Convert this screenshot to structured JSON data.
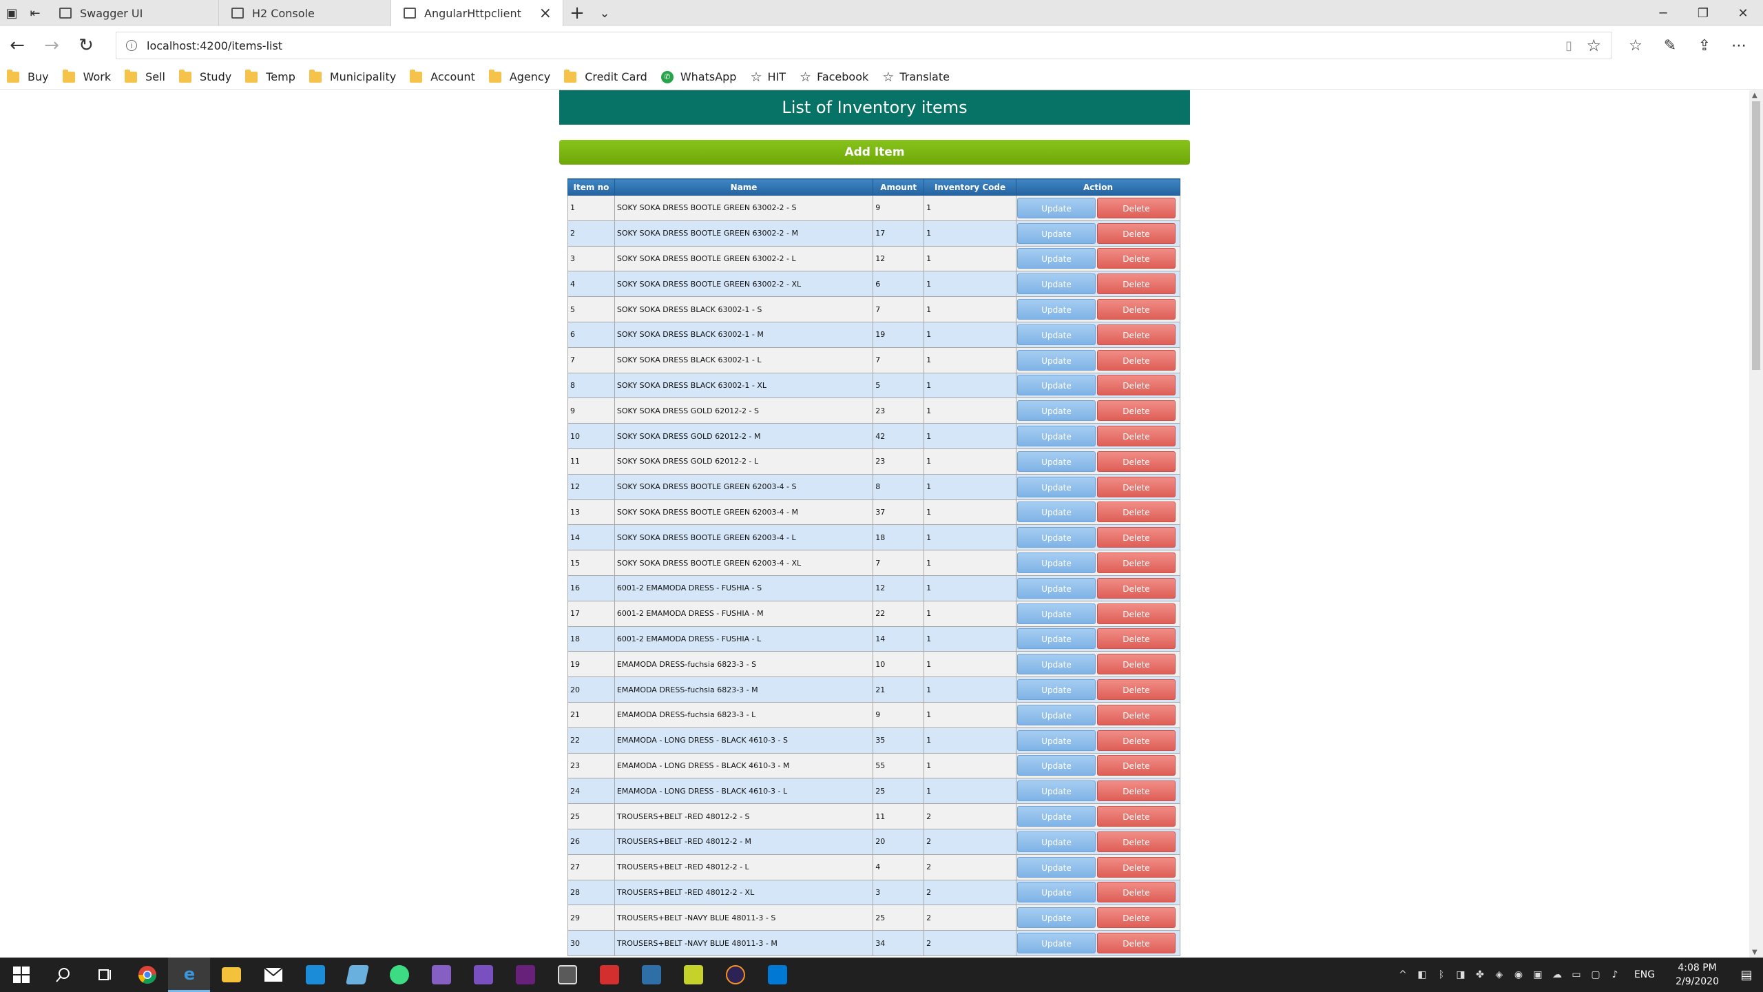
{
  "browser": {
    "tabs": [
      {
        "title": "Swagger UI",
        "active": false
      },
      {
        "title": "H2 Console",
        "active": false
      },
      {
        "title": "AngularHttpclient",
        "active": true
      }
    ],
    "url": "localhost:4200/items-list",
    "favorites": [
      {
        "label": "Buy",
        "icon": "folder-icon"
      },
      {
        "label": "Work",
        "icon": "folder-icon"
      },
      {
        "label": "Sell",
        "icon": "folder-icon"
      },
      {
        "label": "Study",
        "icon": "folder-icon"
      },
      {
        "label": "Temp",
        "icon": "folder-icon"
      },
      {
        "label": "Municipality",
        "icon": "folder-icon"
      },
      {
        "label": "Account",
        "icon": "folder-icon"
      },
      {
        "label": "Agency",
        "icon": "folder-icon"
      },
      {
        "label": "Credit Card",
        "icon": "folder-icon"
      },
      {
        "label": "WhatsApp",
        "icon": "whatsapp-icon"
      },
      {
        "label": "HIT",
        "icon": "star-icon"
      },
      {
        "label": "Facebook",
        "icon": "star-icon"
      },
      {
        "label": "Translate",
        "icon": "star-icon"
      }
    ]
  },
  "page": {
    "title": "List of Inventory items",
    "add_label": "Add Item",
    "columns": [
      "Item no",
      "Name",
      "Amount",
      "Inventory Code",
      "Action"
    ],
    "update_label": "Update",
    "delete_label": "Delete",
    "rows": [
      {
        "no": "1",
        "name": "SOKY SOKA DRESS BOOTLE GREEN 63002-2 - S",
        "amount": "9",
        "code": "1"
      },
      {
        "no": "2",
        "name": "SOKY SOKA DRESS BOOTLE GREEN 63002-2 - M",
        "amount": "17",
        "code": "1"
      },
      {
        "no": "3",
        "name": "SOKY SOKA DRESS BOOTLE GREEN 63002-2 - L",
        "amount": "12",
        "code": "1"
      },
      {
        "no": "4",
        "name": "SOKY SOKA DRESS BOOTLE GREEN 63002-2 - XL",
        "amount": "6",
        "code": "1"
      },
      {
        "no": "5",
        "name": "SOKY SOKA DRESS BLACK 63002-1 - S",
        "amount": "7",
        "code": "1"
      },
      {
        "no": "6",
        "name": "SOKY SOKA DRESS BLACK 63002-1 - M",
        "amount": "19",
        "code": "1"
      },
      {
        "no": "7",
        "name": "SOKY SOKA DRESS BLACK 63002-1 - L",
        "amount": "7",
        "code": "1"
      },
      {
        "no": "8",
        "name": "SOKY SOKA DRESS BLACK 63002-1 - XL",
        "amount": "5",
        "code": "1"
      },
      {
        "no": "9",
        "name": "SOKY SOKA DRESS GOLD 62012-2 - S",
        "amount": "23",
        "code": "1"
      },
      {
        "no": "10",
        "name": "SOKY SOKA DRESS GOLD 62012-2 - M",
        "amount": "42",
        "code": "1"
      },
      {
        "no": "11",
        "name": "SOKY SOKA DRESS GOLD 62012-2 - L",
        "amount": "23",
        "code": "1"
      },
      {
        "no": "12",
        "name": "SOKY SOKA DRESS BOOTLE GREEN 62003-4 - S",
        "amount": "8",
        "code": "1"
      },
      {
        "no": "13",
        "name": "SOKY SOKA DRESS BOOTLE GREEN 62003-4 - M",
        "amount": "37",
        "code": "1"
      },
      {
        "no": "14",
        "name": "SOKY SOKA DRESS BOOTLE GREEN 62003-4 - L",
        "amount": "18",
        "code": "1"
      },
      {
        "no": "15",
        "name": "SOKY SOKA DRESS BOOTLE GREEN 62003-4 - XL",
        "amount": "7",
        "code": "1"
      },
      {
        "no": "16",
        "name": "6001-2 EMAMODA DRESS - FUSHIA - S",
        "amount": "12",
        "code": "1"
      },
      {
        "no": "17",
        "name": "6001-2 EMAMODA DRESS - FUSHIA - M",
        "amount": "22",
        "code": "1"
      },
      {
        "no": "18",
        "name": "6001-2 EMAMODA DRESS - FUSHIA - L",
        "amount": "14",
        "code": "1"
      },
      {
        "no": "19",
        "name": "EMAMODA DRESS-fuchsia 6823-3 - S",
        "amount": "10",
        "code": "1"
      },
      {
        "no": "20",
        "name": "EMAMODA DRESS-fuchsia 6823-3 - M",
        "amount": "21",
        "code": "1"
      },
      {
        "no": "21",
        "name": "EMAMODA DRESS-fuchsia 6823-3 - L",
        "amount": "9",
        "code": "1"
      },
      {
        "no": "22",
        "name": "EMAMODA - LONG DRESS - BLACK 4610-3 - S",
        "amount": "35",
        "code": "1"
      },
      {
        "no": "23",
        "name": "EMAMODA - LONG DRESS - BLACK 4610-3 - M",
        "amount": "55",
        "code": "1"
      },
      {
        "no": "24",
        "name": "EMAMODA - LONG DRESS - BLACK 4610-3 - L",
        "amount": "25",
        "code": "1"
      },
      {
        "no": "25",
        "name": "TROUSERS+BELT -RED 48012-2 - S",
        "amount": "11",
        "code": "2"
      },
      {
        "no": "26",
        "name": "TROUSERS+BELT -RED 48012-2 - M",
        "amount": "20",
        "code": "2"
      },
      {
        "no": "27",
        "name": "TROUSERS+BELT -RED 48012-2 - L",
        "amount": "4",
        "code": "2"
      },
      {
        "no": "28",
        "name": "TROUSERS+BELT -RED 48012-2 - XL",
        "amount": "3",
        "code": "2"
      },
      {
        "no": "29",
        "name": "TROUSERS+BELT -NAVY BLUE 48011-3 - S",
        "amount": "25",
        "code": "2"
      },
      {
        "no": "30",
        "name": "TROUSERS+BELT -NAVY BLUE 48011-3 - M",
        "amount": "34",
        "code": "2"
      }
    ]
  },
  "taskbar": {
    "language": "ENG",
    "time": "4:08 PM",
    "date": "2/9/2020"
  }
}
